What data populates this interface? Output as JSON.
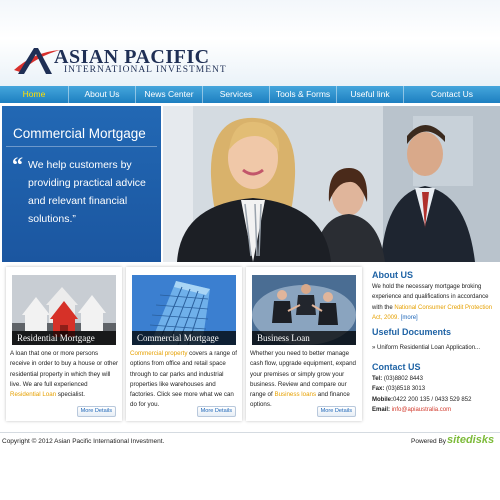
{
  "brand": {
    "title": "ASIAN PACIFIC",
    "subtitle": "INTERNATIONAL INVESTMENT",
    "colors": {
      "navy": "#1f2f55",
      "red": "#d8302c",
      "nav_blue": "#1d7fc0",
      "accent_yellow": "#e6a000"
    }
  },
  "nav": {
    "items": [
      {
        "label": "Home",
        "active": true
      },
      {
        "label": "About Us"
      },
      {
        "label": "News Center"
      },
      {
        "label": "Services"
      },
      {
        "label": "Tools & Forms"
      },
      {
        "label": "Useful link"
      },
      {
        "label": "Contact Us"
      }
    ]
  },
  "hero": {
    "title": "Commercial Mortgage",
    "quote_mark": "“",
    "quote": "We help customers by providing practical advice and relevant financial solutions.”"
  },
  "boxes": [
    {
      "caption": "Residential Mortgage",
      "text_before": "A loan that one or more persons receive in order to buy a house or other residential property in which they will live. We are full experienced ",
      "highlight": "Residential Loan",
      "text_after": " specialist.",
      "more": "More Details"
    },
    {
      "caption": "Commercial Mortgage",
      "highlight": "Commercial property",
      "text_after": " covers a range of options from office and retail space through to car parks and industrial properties like warehouses and factories. Click see more what we can do for you.",
      "more": "More Details"
    },
    {
      "caption": "Business Loan",
      "text_before": "Whether you need to better manage cash flow, upgrade equipment, expand your premises or simply grow your business. Review and compare our range of ",
      "highlight": "Business loans",
      "text_after": " and finance options.",
      "more": "More Details"
    }
  ],
  "side": {
    "about_heading": "About US",
    "about_text": "We hold the necessary mortgage broking experience and qualifications in accordance with the ",
    "about_link": "National Consumer Credit Protection Act, 2009.",
    "about_more": "[more]",
    "docs_heading": "Useful Documents",
    "docs_item": "» Uniform Residential Loan Application...",
    "contact_heading": "Contact US",
    "tel_label": "Tel:",
    "tel": "(03)8802 8443",
    "fax_label": "Fax:",
    "fax": "(03)8518 3013",
    "mobile_label": "Mobile:",
    "mobile": "0422 200 135 / 0433 529 852",
    "email_label": "Email:",
    "email": "info@apiaustralia.com"
  },
  "footer": {
    "copyright": "Copyright © 2012 Asian Pacific International Investment.",
    "powered": "Powered By",
    "powered_brand": "sitedisks"
  },
  "icons": [
    "logo-mark-icon",
    "quote-icon"
  ]
}
